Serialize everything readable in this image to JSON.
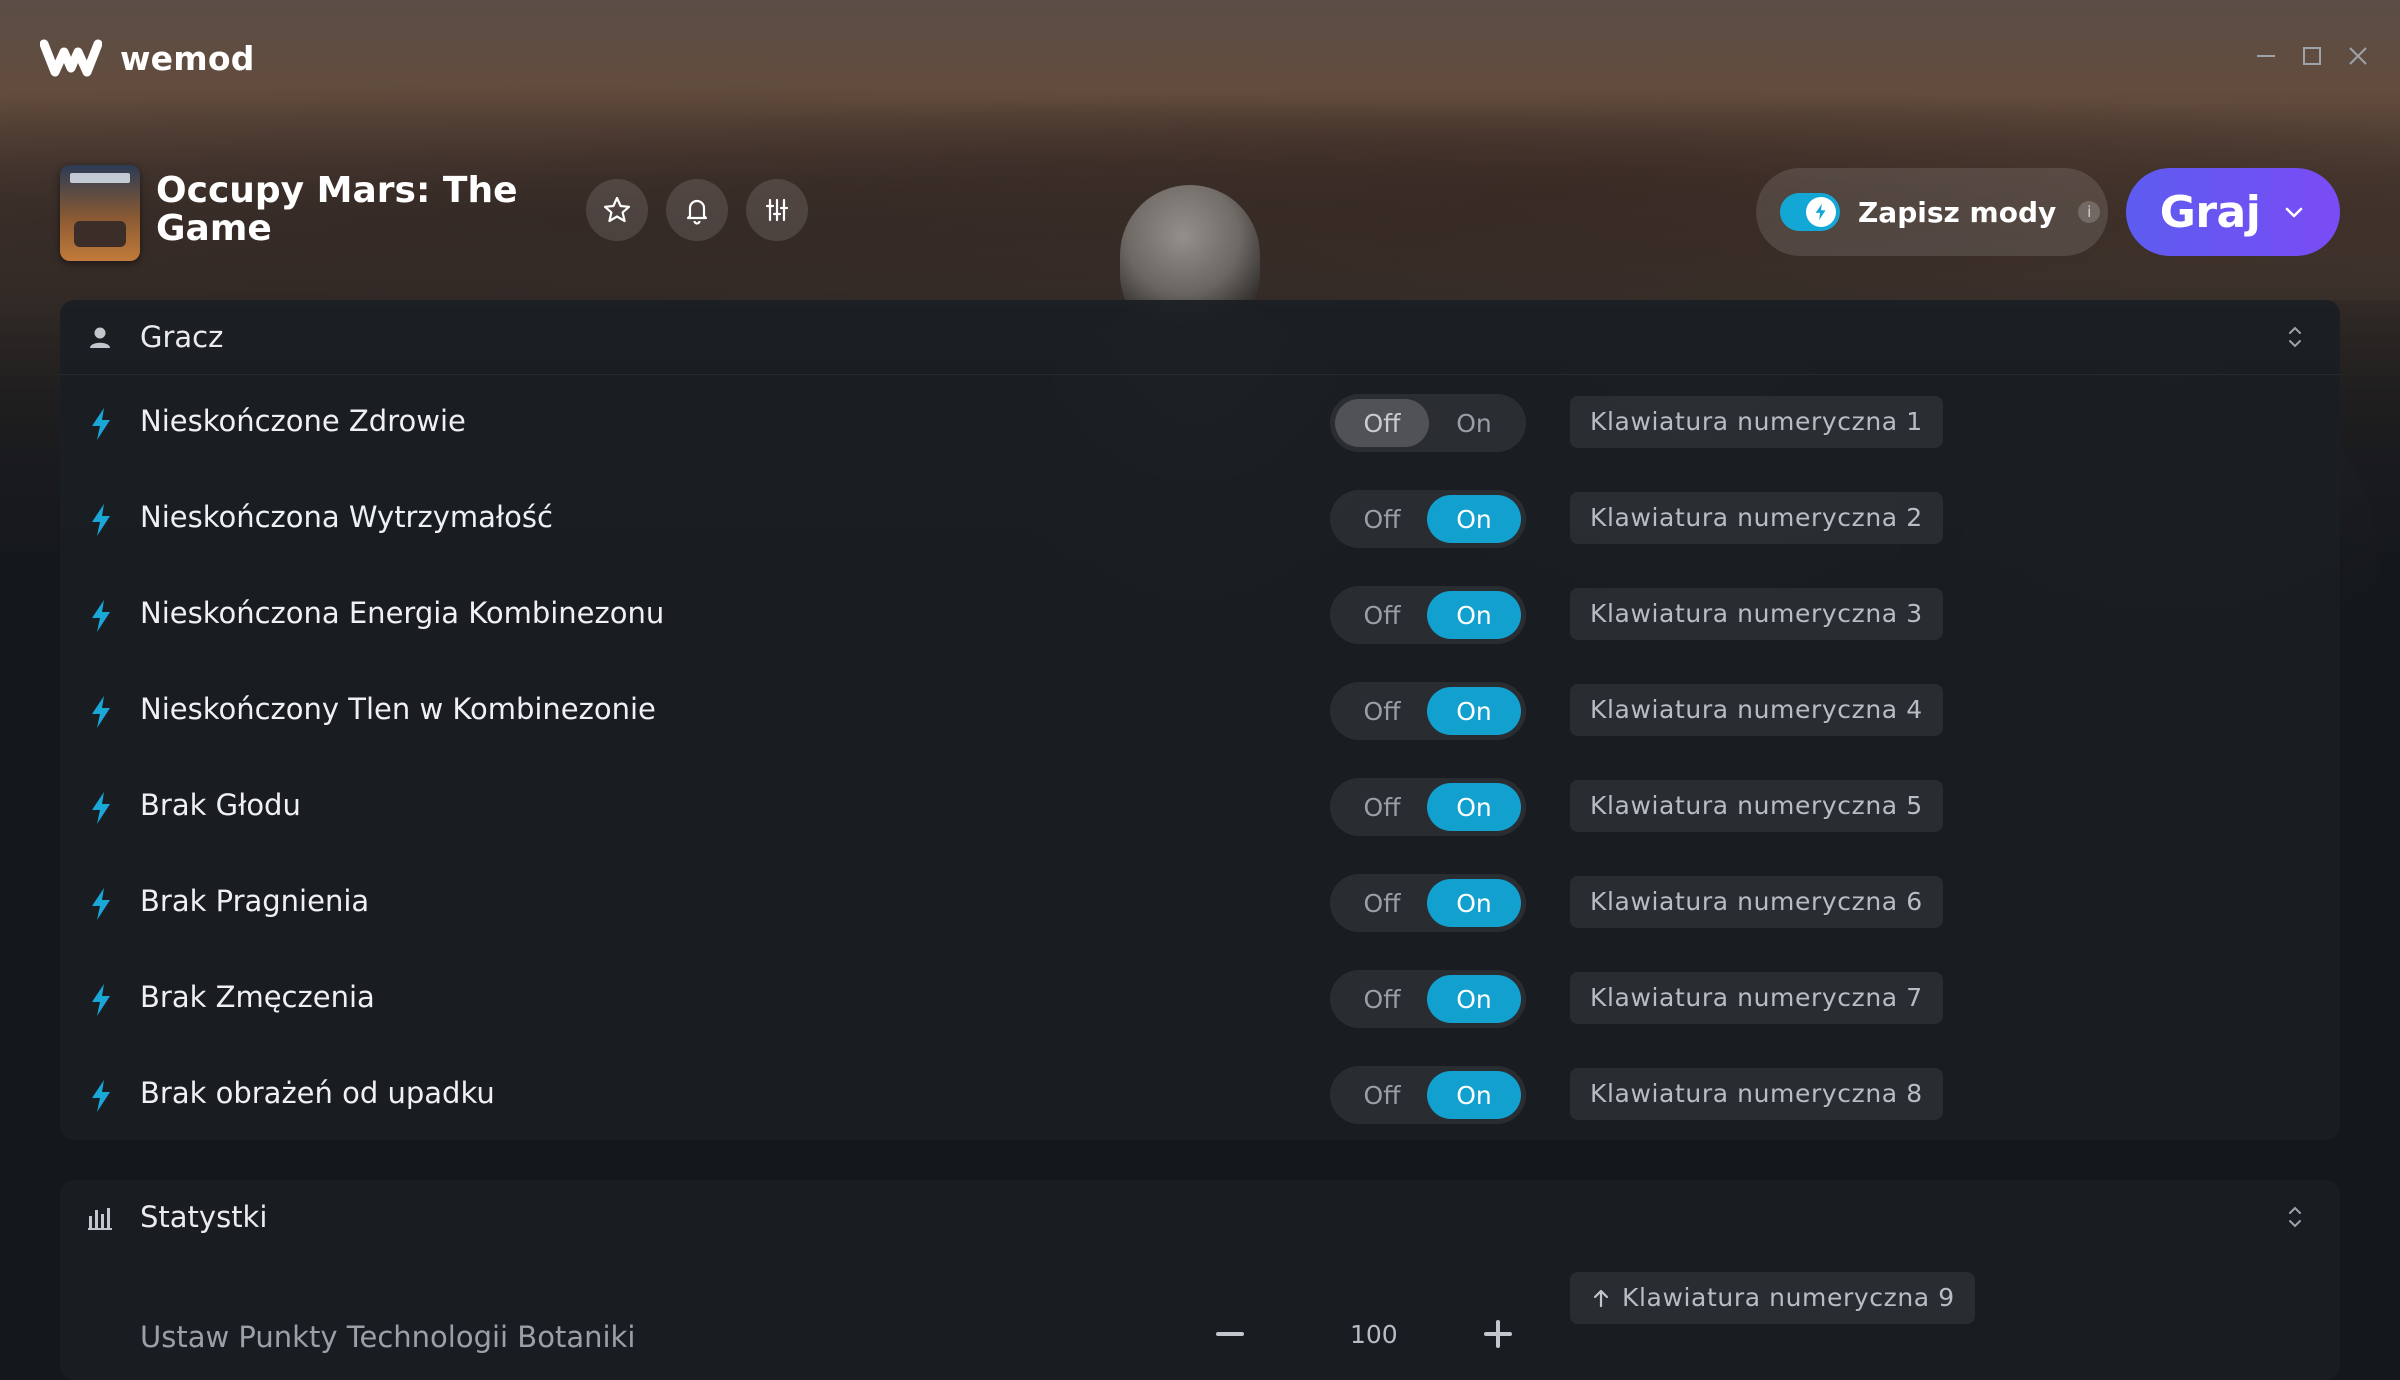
{
  "app": {
    "name": "wemod"
  },
  "game": {
    "title": "Occupy Mars: The Game"
  },
  "header": {
    "save_mods_label": "Zapisz mody",
    "save_mods_info": "i",
    "play_label": "Graj"
  },
  "sections": [
    {
      "title": "Gracz",
      "icon": "user-icon",
      "mods": [
        {
          "name": "Nieskończone Zdrowie",
          "off": "Off",
          "on": "On",
          "state": "off",
          "hotkey": "Klawiatura numeryczna 1"
        },
        {
          "name": "Nieskończona Wytrzymałość",
          "off": "Off",
          "on": "On",
          "state": "on",
          "hotkey": "Klawiatura numeryczna 2"
        },
        {
          "name": "Nieskończona Energia Kombinezonu",
          "off": "Off",
          "on": "On",
          "state": "on",
          "hotkey": "Klawiatura numeryczna 3"
        },
        {
          "name": "Nieskończony Tlen w Kombinezonie",
          "off": "Off",
          "on": "On",
          "state": "on",
          "hotkey": "Klawiatura numeryczna 4"
        },
        {
          "name": "Brak Głodu",
          "off": "Off",
          "on": "On",
          "state": "on",
          "hotkey": "Klawiatura numeryczna 5"
        },
        {
          "name": "Brak Pragnienia",
          "off": "Off",
          "on": "On",
          "state": "on",
          "hotkey": "Klawiatura numeryczna 6"
        },
        {
          "name": "Brak Zmęczenia",
          "off": "Off",
          "on": "On",
          "state": "on",
          "hotkey": "Klawiatura numeryczna 7"
        },
        {
          "name": "Brak obrażeń od upadku",
          "off": "Off",
          "on": "On",
          "state": "on",
          "hotkey": "Klawiatura numeryczna 8"
        }
      ]
    },
    {
      "title": "Statystki",
      "icon": "bar-chart-icon",
      "stat": {
        "name": "Ustaw Punkty Technologii Botaniki",
        "value": "100",
        "hotkey": "Klawiatura numeryczna 9"
      }
    }
  ],
  "colors": {
    "accent": "#12a1cf",
    "play": "#6a55f2"
  }
}
